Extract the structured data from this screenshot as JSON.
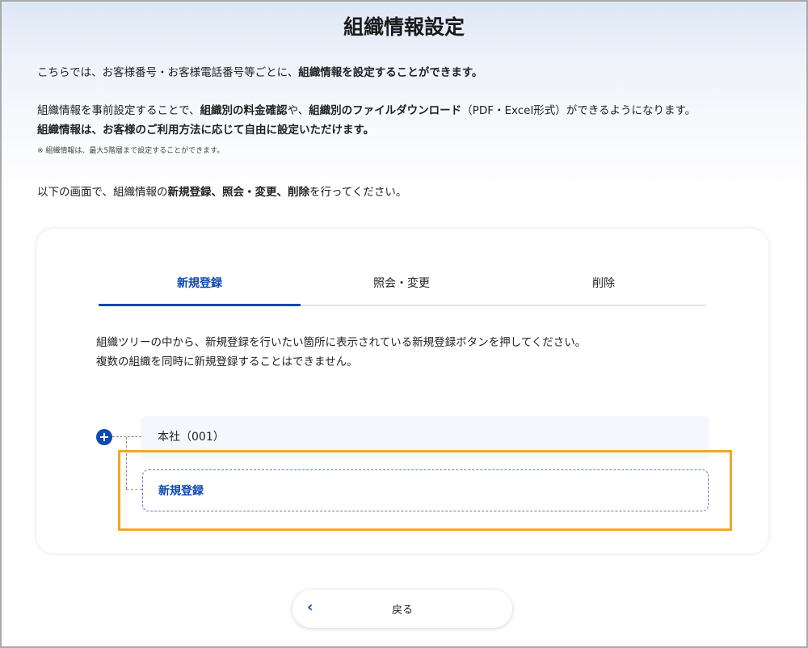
{
  "page_title": "組織情報設定",
  "intro": {
    "line1_normal": "こちらでは、お客様番号・お客様電話番号等ごとに、",
    "line1_bold": "組織情報を設定することができます。",
    "line2_a": "組織情報を事前設定することで、",
    "line2_b": "組織別の料金確認",
    "line2_c": "や、",
    "line2_d": "組織別のファイルダウンロード",
    "line2_e": "（PDF・Excel形式）ができるようになります。",
    "line3": "組織情報は、お客様のご利用方法に応じて自由に設定いただけます。",
    "note": "※ 組織情報は、最大5階層まで設定することができます。",
    "line4_a": "以下の画面で、組織情報の",
    "line4_b": "新規登録、照会・変更、削除",
    "line4_c": "を行ってください。"
  },
  "tabs": [
    {
      "label": "新規登録",
      "active": true
    },
    {
      "label": "照会・変更",
      "active": false
    },
    {
      "label": "削除",
      "active": false
    }
  ],
  "description": [
    "組織ツリーの中から、新規登録を行いたい箇所に表示されている新規登録ボタンを押してください。",
    "複数の組織を同時に新規登録することはできません。"
  ],
  "tree": {
    "root_label": "本社（001）",
    "expand_icon": "plus-icon",
    "new_entry_label": "新規登録"
  },
  "back_button": {
    "label": "戻る",
    "icon": "chevron-left-icon"
  },
  "colors": {
    "accent": "#0d48b3",
    "highlight": "#f2a728"
  }
}
